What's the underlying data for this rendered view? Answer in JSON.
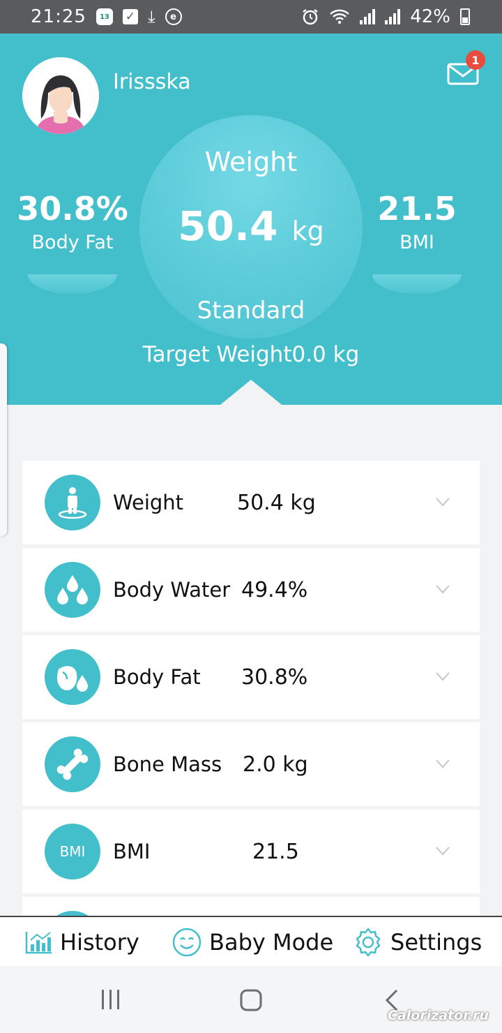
{
  "status_bar": {
    "time": "21:25",
    "calendar_badge": "13",
    "battery_pct": "42%"
  },
  "profile": {
    "username": "Irissska",
    "mail_count": "1"
  },
  "summary": {
    "center_label": "Weight",
    "center_value": "50.4",
    "center_unit": "kg",
    "status": "Standard",
    "target_label": "Target Weight",
    "target_value": "0.0 kg",
    "left_value": "30.8%",
    "left_label": "Body Fat",
    "right_value": "21.5",
    "right_label": "BMI"
  },
  "metrics": [
    {
      "label": "Weight",
      "value": "50.4 kg",
      "icon": "person-scale-icon"
    },
    {
      "label": "Body Water",
      "value": "49.4%",
      "icon": "water-drops-icon"
    },
    {
      "label": "Body Fat",
      "value": "30.8%",
      "icon": "fat-drop-icon"
    },
    {
      "label": "Bone Mass",
      "value": "2.0 kg",
      "icon": "bone-icon"
    },
    {
      "label": "BMI",
      "value": "21.5",
      "icon": "bmi-icon",
      "icon_text": "BMI"
    }
  ],
  "bottom_nav": [
    {
      "label": "History",
      "icon": "chart-icon"
    },
    {
      "label": "Baby Mode",
      "icon": "smiley-icon"
    },
    {
      "label": "Settings",
      "icon": "gear-icon"
    }
  ],
  "watermark": "Calorizator.ru",
  "colors": {
    "accent": "#43bfcb",
    "badge": "#e94b3c",
    "statusbar": "#5a5b5d"
  }
}
